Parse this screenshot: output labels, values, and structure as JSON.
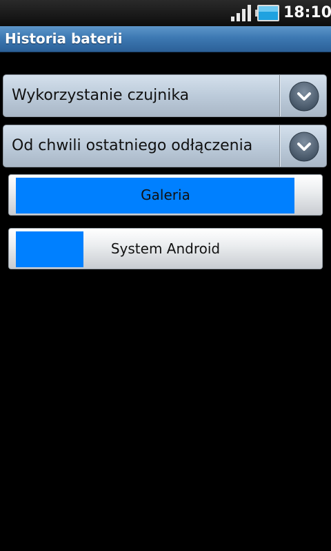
{
  "status_bar": {
    "time": "18:10",
    "signal_icon": "signal-strength-icon",
    "battery_icon": "battery-icon"
  },
  "title_bar": {
    "title": "Historia baterii"
  },
  "spinners": [
    {
      "label": "Wykorzystanie czujnika",
      "icon": "chevron-down-icon"
    },
    {
      "label": "Od chwili ostatniego odłączenia",
      "icon": "chevron-down-icon"
    }
  ],
  "usage_items": [
    {
      "label": "Galeria",
      "fraction": 0.91
    },
    {
      "label": "System Android",
      "fraction": 0.22
    }
  ],
  "colors": {
    "usage_fill": "#0080ff",
    "title_bar": "#3d79b3"
  }
}
